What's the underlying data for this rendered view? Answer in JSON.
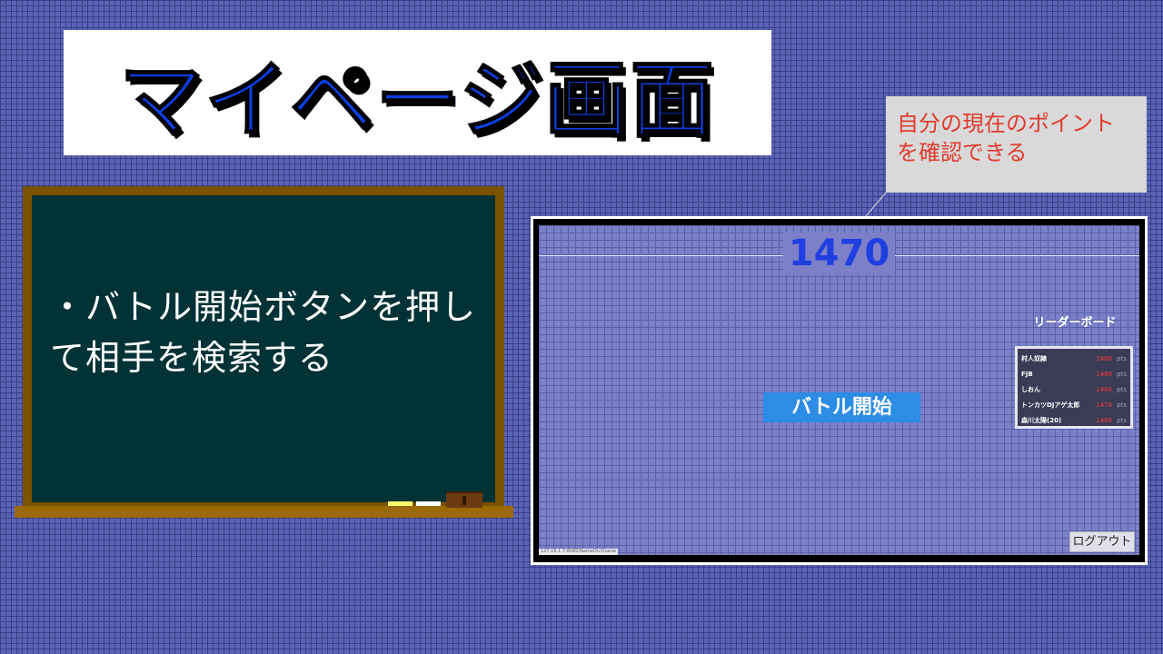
{
  "title": "マイページ画面",
  "blackboard": {
    "text": "・バトル開始ボタンを押して相手を検索する"
  },
  "callout": {
    "text": "自分の現在のポイントを確認できる"
  },
  "screen": {
    "points": "1470",
    "battle_button_label": "バトル開始",
    "leaderboard_title": "リーダーボード",
    "leaderboard": [
      {
        "name": "村人奴隷",
        "score": "1480",
        "unit": "pts"
      },
      {
        "name": "FJB",
        "score": "1480",
        "unit": "pts"
      },
      {
        "name": "しおん",
        "score": "1480",
        "unit": "pts"
      },
      {
        "name": "トンカツDJアゲ太郎",
        "score": "1470",
        "unit": "pts"
      },
      {
        "name": "森川太陽(20)",
        "score": "1460",
        "unit": "pts"
      }
    ],
    "logout_label": "ログアウト",
    "url": "127.16.1.7:8080/NameOn/Queue"
  },
  "colors": {
    "title_blue": "#0b3fe6",
    "points_blue": "#1f3fe0",
    "callout_red": "#e23b2e",
    "battle_button": "#2c8ce6",
    "score_red": "#ff3a3a"
  }
}
